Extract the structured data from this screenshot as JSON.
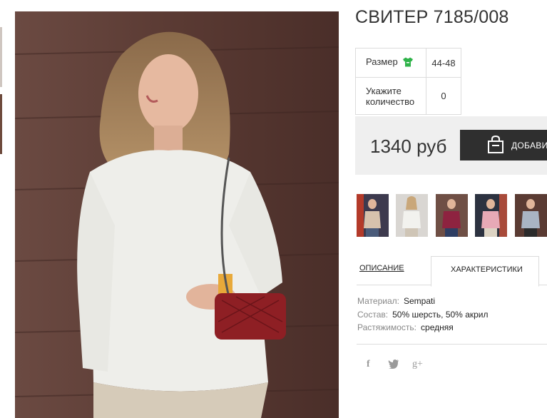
{
  "product": {
    "title": "СВИТЕР 7185/008",
    "specs": {
      "size_label": "Размер",
      "size_value": "44-48",
      "quantity_label": "Укажите количество",
      "quantity_value": "0"
    },
    "price": "1340 руб",
    "add_to_cart_label": "ДОБАВИТЬ"
  },
  "tabs": [
    {
      "label": "ОПИСАНИЕ",
      "active": false
    },
    {
      "label": "ХАРАКТЕРИСТИКИ",
      "active": true
    }
  ],
  "characteristics": [
    {
      "key": "Материал:",
      "value": "Sempati"
    },
    {
      "key": "Состав:",
      "value": "50% шерсть, 50% акрил"
    },
    {
      "key": "Растяжимость:",
      "value": "средняя"
    }
  ],
  "social": [
    {
      "glyph": "f",
      "icon": "facebook-icon"
    },
    {
      "glyph": "🐦",
      "icon": "twitter-icon"
    },
    {
      "glyph": "g+",
      "icon": "google-plus-icon"
    }
  ],
  "gallery": [
    {
      "icon": "photo-thumbnail-beige-sweater"
    },
    {
      "icon": "photo-thumbnail-white-sweater"
    },
    {
      "icon": "photo-thumbnail-burgundy-sweater"
    },
    {
      "icon": "photo-thumbnail-pink-sweater"
    },
    {
      "icon": "photo-thumbnail-grey-sweater"
    }
  ],
  "colors": {
    "size_icon": "#2fb34a",
    "button_bg": "#2f2f2f",
    "price_box_bg": "#efefef"
  }
}
